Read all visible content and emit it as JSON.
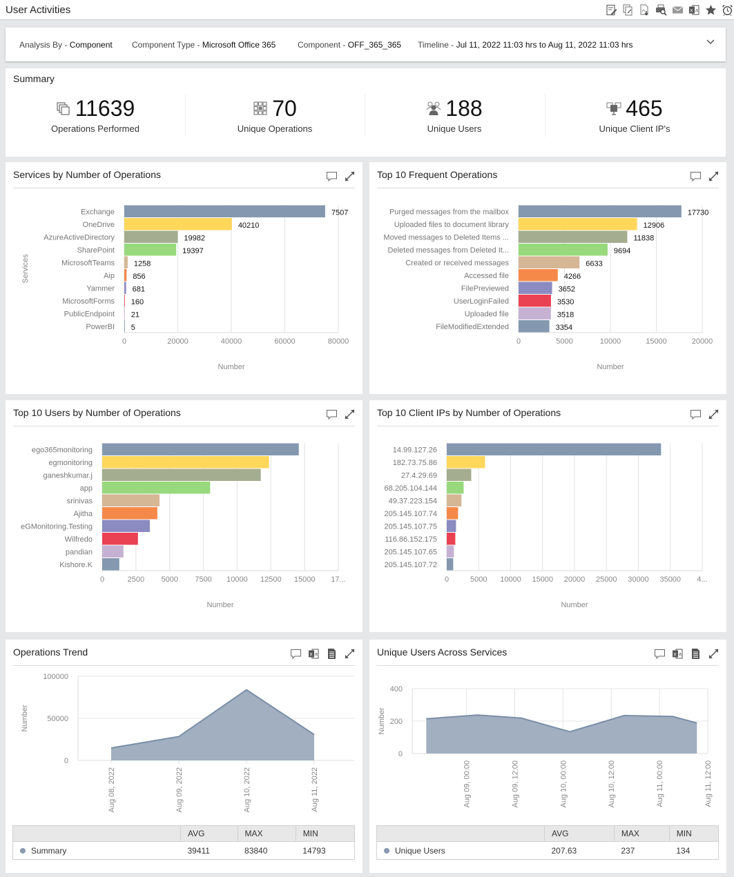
{
  "header": {
    "title": "User Activities",
    "tools": [
      {
        "icon": "edit-report-icon",
        "label": "Edit report"
      },
      {
        "icon": "copy-report-icon",
        "label": "Copy report"
      },
      {
        "icon": "pdf-download-icon",
        "label": "Download PDF"
      },
      {
        "icon": "print-preview-icon",
        "label": "Print preview"
      },
      {
        "icon": "mail-icon",
        "label": "Email"
      },
      {
        "icon": "excel-icon",
        "label": "Export to Excel"
      },
      {
        "icon": "star-icon",
        "label": "Favorite"
      },
      {
        "icon": "alarm-clock-icon",
        "label": "Schedule"
      }
    ]
  },
  "filters": {
    "analysis_by_label": "Analysis By - ",
    "analysis_by_value": "Component",
    "component_type_label": "Component Type - ",
    "component_type_value": "Microsoft Office 365",
    "component_label": "Component - ",
    "component_value": "OFF_365_365",
    "timeline_label": "Timeline - ",
    "timeline_value": "Jul 11, 2022 11:03 hrs to Aug 11, 2022 11:03 hrs"
  },
  "summary": {
    "title": "Summary",
    "kpis": [
      {
        "icon": "operations-icon",
        "value": "11639",
        "label": "Operations Performed"
      },
      {
        "icon": "grid-icon",
        "value": "70",
        "label": "Unique Operations"
      },
      {
        "icon": "users-icon",
        "value": "188",
        "label": "Unique Users"
      },
      {
        "icon": "client-ip-icon",
        "value": "465",
        "label": "Unique Client IP's"
      }
    ]
  },
  "colors": {
    "palette": [
      "#8499b0",
      "#ffd75a",
      "#a4ad8f",
      "#98d97d",
      "#d5b796",
      "#f5894a",
      "#8b8bc2",
      "#ea4153",
      "#c5b2d2",
      "#8499b0"
    ],
    "area_fill": "#a1afc1",
    "area_line": "#7a8ea6"
  },
  "chart_data": [
    {
      "id": "services",
      "type": "bar",
      "orientation": "horizontal",
      "title": "Services by Number of Operations",
      "xlabel": "Number",
      "ylabel": "Services",
      "xlim": [
        0,
        80000
      ],
      "xticks": [
        "0",
        "20000",
        "40000",
        "60000",
        "80000"
      ],
      "grid": true,
      "categories": [
        "Exchange",
        "OneDrive",
        "AzureActiveDirectory",
        "SharePoint",
        "MicrosoftTeams",
        "Aip",
        "Yammer",
        "MicrosoftForms",
        "PublicEndpoint",
        "PowerBI"
      ],
      "values": [
        75070,
        40210,
        19982,
        19397,
        1258,
        856,
        681,
        160,
        21,
        5
      ],
      "value_labels": [
        "7507",
        "40210",
        "19982",
        "19397",
        "1258",
        "856",
        "681",
        "160",
        "21",
        "5"
      ]
    },
    {
      "id": "operations",
      "type": "bar",
      "orientation": "horizontal",
      "title": "Top 10 Frequent Operations",
      "xlabel": "Number",
      "ylabel": "",
      "xlim": [
        0,
        20000
      ],
      "xticks": [
        "0",
        "5000",
        "10000",
        "15000",
        "20000"
      ],
      "grid": true,
      "categories": [
        "Purged messages from the mailbox",
        "Uploaded files to document library",
        "Moved messages to Deleted Items ...",
        "Deleted messages from Deleted It...",
        "Created or received messages",
        "Accessed file",
        "FilePreviewed",
        "UserLoginFailed",
        "Uploaded file",
        "FileModifiedExtended"
      ],
      "values": [
        17730,
        12906,
        11838,
        9694,
        6633,
        4266,
        3652,
        3530,
        3518,
        3354
      ],
      "value_labels": [
        "17730",
        "12906",
        "11838",
        "9694",
        "6633",
        "4266",
        "3652",
        "3530",
        "3518",
        "3354"
      ]
    },
    {
      "id": "users",
      "type": "bar",
      "orientation": "horizontal",
      "title": "Top 10 Users by Number of Operations",
      "xlabel": "Number",
      "ylabel": "",
      "xlim": [
        0,
        17500
      ],
      "xticks": [
        "0",
        "2500",
        "5000",
        "7500",
        "10000",
        "12500",
        "15000",
        "17..."
      ],
      "grid": true,
      "categories": [
        "ego365monitoring",
        "egmonitoring",
        "ganeshkumar.j",
        "app",
        "srinivas",
        "Ajitha",
        "eGMonitoring.Testing",
        "Wilfredo",
        "pandian",
        "Kishore.K"
      ],
      "values": [
        14570,
        12360,
        11750,
        8000,
        4250,
        4090,
        3530,
        2650,
        1575,
        1270
      ]
    },
    {
      "id": "client_ips",
      "type": "bar",
      "orientation": "horizontal",
      "title": "Top 10 Client IPs by Number of Operations",
      "xlabel": "Number",
      "ylabel": "",
      "xlim": [
        0,
        40000
      ],
      "xticks": [
        "0",
        "5000",
        "10000",
        "15000",
        "20000",
        "25000",
        "30000",
        "35000",
        "4..."
      ],
      "grid": true,
      "categories": [
        "14.99.127.26",
        "182.73.75.86",
        "27.4.29.69",
        "68.205.104.144",
        "49.37.223.154",
        "205.145.107.74",
        "205.145.107.75",
        "116.86.152.175",
        "205.145.107.65",
        "205.145.107.72"
      ],
      "values": [
        33550,
        6000,
        3830,
        2640,
        2310,
        1770,
        1450,
        1340,
        1120,
        1010
      ]
    },
    {
      "id": "ops_trend",
      "type": "area",
      "title": "Operations Trend",
      "xlabel": "",
      "ylabel": "Number",
      "ylim": [
        0,
        100000
      ],
      "yticks": [
        "0",
        "50000",
        "100000"
      ],
      "grid": true,
      "x": [
        "Aug 08, 2022",
        "Aug 09, 2022",
        "Aug 10, 2022",
        "Aug 11, 2022"
      ],
      "series": [
        {
          "name": "Summary",
          "values": [
            14793,
            28300,
            83840,
            30711
          ]
        }
      ],
      "stats": {
        "headers": [
          "AVG",
          "MAX",
          "MIN"
        ],
        "rows": [
          {
            "name": "Summary",
            "avg": "39411",
            "max": "83840",
            "min": "14793"
          }
        ]
      }
    },
    {
      "id": "unique_users",
      "type": "area",
      "title": "Unique Users Across Services",
      "xlabel": "",
      "ylabel": "Number",
      "ylim": [
        0,
        400
      ],
      "yticks": [
        "0",
        "200",
        "400"
      ],
      "grid": true,
      "xticks": [
        "Aug 09, 00:00",
        "Aug 09, 12:00",
        "Aug 10, 00:00",
        "Aug 10, 12:00",
        "Aug 11, 00:00",
        "Aug 11, 12:00"
      ],
      "x_hours_from_aug09": [
        -10,
        2.8,
        13.7,
        25.7,
        39.2,
        51.3,
        57.3
      ],
      "x_range_hours": [
        -13.5,
        60
      ],
      "series": [
        {
          "name": "Unique Users",
          "values": [
            214,
            237,
            218,
            134,
            234,
            228,
            188
          ]
        }
      ],
      "stats": {
        "headers": [
          "AVG",
          "MAX",
          "MIN"
        ],
        "rows": [
          {
            "name": "Unique Users",
            "avg": "207.63",
            "max": "237",
            "min": "134"
          }
        ]
      }
    }
  ]
}
